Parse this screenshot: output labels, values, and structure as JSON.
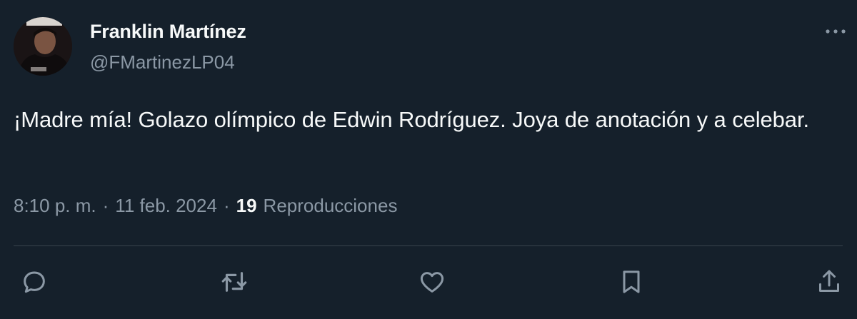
{
  "author": {
    "name": "Franklin Martínez",
    "handle": "@FMartinezLP04"
  },
  "tweet": {
    "text": "¡Madre mía! Golazo olímpico de Edwin Rodríguez. Joya de anotación y a celebar.",
    "time": "8:10 p. m.",
    "separator": "·",
    "date": "11 feb. 2024",
    "views_count": "19",
    "views_label": "Reproducciones"
  },
  "icons": {
    "more": "more-horizontal-icon",
    "reply": "reply-icon",
    "retweet": "retweet-icon",
    "like": "heart-icon",
    "bookmark": "bookmark-icon",
    "share": "share-icon"
  },
  "colors": {
    "background": "#15202b",
    "primary_text": "#f7f9f9",
    "secondary_text": "#8b98a5",
    "divider": "#38444d"
  }
}
